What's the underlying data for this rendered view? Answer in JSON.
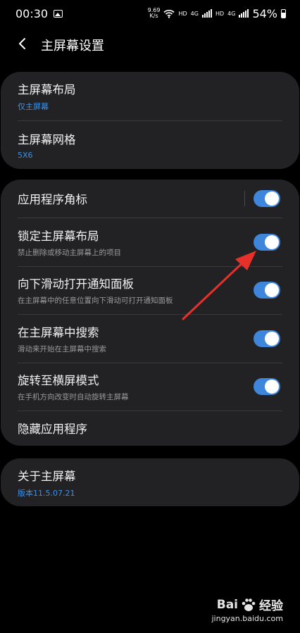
{
  "status_bar": {
    "time": "00:30",
    "net_speed_value": "9.69",
    "net_speed_unit": "K/s",
    "hd1": "HD",
    "lte1": "4G",
    "hd2": "HD",
    "lte2": "4G",
    "battery": "54%"
  },
  "header": {
    "title": "主屏幕设置"
  },
  "card1": [
    {
      "title": "主屏幕布局",
      "subtitle": "仅主屏幕"
    },
    {
      "title": "主屏幕网格",
      "subtitle": "5X6"
    }
  ],
  "card2": [
    {
      "title": "应用程序角标",
      "toggle_on": true
    },
    {
      "title": "锁定主屏幕布局",
      "subtitle": "禁止删除或移动主屏幕上的项目",
      "toggle_on": true
    },
    {
      "title": "向下滑动打开通知面板",
      "subtitle": "在主屏幕中的任意位置向下滑动可打开通知面板",
      "toggle_on": true
    },
    {
      "title": "在主屏幕中搜索",
      "subtitle": "滑动来开始在主屏幕中搜索",
      "toggle_on": true
    },
    {
      "title": "旋转至横屏模式",
      "subtitle": "在手机方向改变时自动旋转主屏幕",
      "toggle_on": true
    },
    {
      "title": "隐藏应用程序"
    }
  ],
  "card3": [
    {
      "title": "关于主屏幕",
      "subtitle": "版本11.5.07.21"
    }
  ],
  "watermark": {
    "brand_left": "Bai",
    "brand_right": "经验",
    "url": "jingyan.baidu.com"
  },
  "colors": {
    "accent": "#3d86dc",
    "link_blue": "#3e91e6",
    "card_bg": "#222225",
    "annotation_red": "#e8302a"
  }
}
